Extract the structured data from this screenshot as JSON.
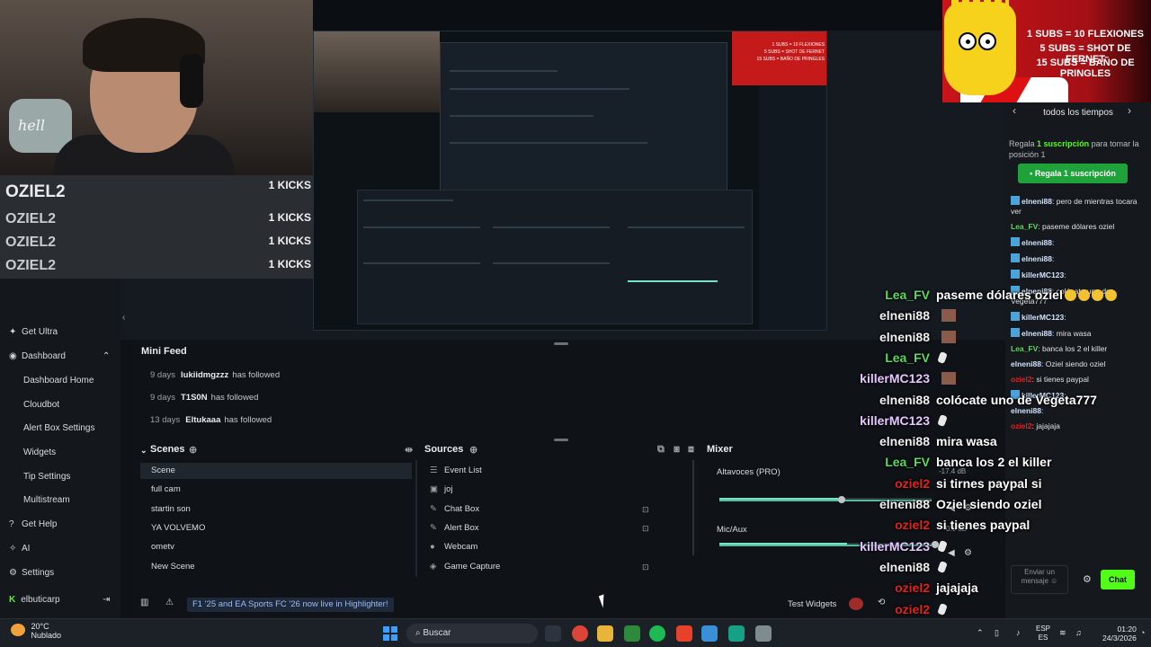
{
  "kicks": [
    {
      "name": "OZIEL2",
      "count": "1 KICKS"
    },
    {
      "name": "OZIEL2",
      "count": "1 KICKS"
    },
    {
      "name": "OZIEL2",
      "count": "1 KICKS"
    },
    {
      "name": "OZIEL2",
      "count": "1 KICKS"
    }
  ],
  "bart_overlay": {
    "line1": "1 SUBS = 10 FLEXIONES",
    "line2": "5 SUBS = SHOT DE FERNET",
    "line3": "15 SUBS = BAÑO DE PRINGLES"
  },
  "chat_side": {
    "header": "todos los tiempos",
    "gift_desc_pre": "Regala",
    "gift_desc_bold": "1 suscripción",
    "gift_desc_post": "para tomar la posición 1",
    "gift_button": "Regala 1 suscripción",
    "messages": [
      {
        "user": "elneni88",
        "text": ": pero de mientras tocara ver",
        "cls": "user-elneni",
        "badge": true
      },
      {
        "user": "Lea_FV",
        "text": ": paseme dólares oziel",
        "cls": "user-lea",
        "badge": false
      },
      {
        "user": "elneni88",
        "text": ":",
        "cls": "user-elneni",
        "badge": true
      },
      {
        "user": "elneni88",
        "text": ":",
        "cls": "user-elneni",
        "badge": true
      },
      {
        "user": "killerMC123",
        "text": ":",
        "cls": "user-killer",
        "badge": true
      },
      {
        "user": "elneni88",
        "text": ": colócate uno de Vegeta777",
        "cls": "user-elneni",
        "badge": true
      },
      {
        "user": "killerMC123",
        "text": ":",
        "cls": "user-killer",
        "badge": true
      },
      {
        "user": "elneni88",
        "text": ": mira wasa",
        "cls": "user-elneni",
        "badge": true
      },
      {
        "user": "Lea_FV",
        "text": ": banca los 2 el killer",
        "cls": "user-lea",
        "badge": false
      },
      {
        "user": "elneni88",
        "text": ": Oziel siendo oziel",
        "cls": "user-elneni",
        "badge": false
      },
      {
        "user": "oziel2",
        "text": ": si tienes paypal",
        "cls": "user-elneni",
        "badge": false
      },
      {
        "user": "killerMC123",
        "text": ":",
        "cls": "user-killer",
        "badge": true
      },
      {
        "user": "elneni88",
        "text": ":",
        "cls": "user-elneni",
        "badge": false
      },
      {
        "user": "oziel2",
        "text": ": jajajaja",
        "cls": "user-elneni",
        "badge": false
      }
    ],
    "input_placeholder": "Enviar un mensaje",
    "send_label": "Chat"
  },
  "sidebar": {
    "items": [
      {
        "label": "Get Ultra",
        "icon": "rocket-icon",
        "glyph": "✦",
        "sub": false
      },
      {
        "label": "Dashboard",
        "icon": "dashboard-icon",
        "glyph": "◉",
        "sub": false
      },
      {
        "label": "Dashboard Home",
        "icon": "",
        "glyph": "",
        "sub": true
      },
      {
        "label": "Cloudbot",
        "icon": "",
        "glyph": "",
        "sub": true
      },
      {
        "label": "Alert Box Settings",
        "icon": "",
        "glyph": "",
        "sub": true
      },
      {
        "label": "Widgets",
        "icon": "",
        "glyph": "",
        "sub": true
      },
      {
        "label": "Tip Settings",
        "icon": "",
        "glyph": "",
        "sub": true
      },
      {
        "label": "Multistream",
        "icon": "",
        "glyph": "",
        "sub": true
      },
      {
        "label": "Get Help",
        "icon": "help-icon",
        "glyph": "?",
        "sub": false
      },
      {
        "label": "AI",
        "icon": "ai-icon",
        "glyph": "✧",
        "sub": false
      },
      {
        "label": "Settings",
        "icon": "gear-icon",
        "glyph": "⚙",
        "sub": false
      }
    ],
    "user": "elbuticarp"
  },
  "mini_feed": {
    "title": "Mini Feed",
    "rows": [
      {
        "time": "9 days",
        "who": "lukiidmgzzz",
        "action": "has followed"
      },
      {
        "time": "9 days",
        "who": "T1S0N",
        "action": "has followed"
      },
      {
        "time": "13 days",
        "who": "Eltukaaa",
        "action": "has followed"
      }
    ]
  },
  "scenes": {
    "title": "Scenes",
    "items": [
      "Scene",
      "full cam",
      "startin son",
      "YA VOLVEMO",
      "ometv",
      "New Scene"
    ]
  },
  "sources": {
    "title": "Sources",
    "items": [
      {
        "label": "Event List",
        "icon": "list-icon",
        "glyph": "☰",
        "lock": false
      },
      {
        "label": "joj",
        "icon": "image-icon",
        "glyph": "▣",
        "lock": false
      },
      {
        "label": "Chat Box",
        "icon": "chat-icon",
        "glyph": "✎",
        "lock": true
      },
      {
        "label": "Alert Box",
        "icon": "alert-icon",
        "glyph": "✎",
        "lock": true
      },
      {
        "label": "Webcam",
        "icon": "webcam-icon",
        "glyph": "●",
        "lock": false
      },
      {
        "label": "Game Capture",
        "icon": "gamepad-icon",
        "glyph": "◈",
        "lock": true
      }
    ]
  },
  "mixer": {
    "title": "Mixer",
    "channels": [
      {
        "label": "Altavoces (PRO)",
        "db": "-17.4 dB",
        "level": 0.8
      },
      {
        "label": "Mic/Aux",
        "db": "0.0 dB",
        "level": 0.0
      }
    ]
  },
  "statusbar": {
    "notification": "F1 '25 and EA Sports FC '26 now live in Highlighter!",
    "test_widgets": "Test Widgets"
  },
  "overlay_chat": [
    {
      "user": "Lea_FV",
      "text": "paseme dólares oziel",
      "color": "#5dd75d"
    },
    {
      "user": "elneni88",
      "text": "",
      "color": "#f0f0f0"
    },
    {
      "user": "elneni88",
      "text": "",
      "color": "#f0f0f0"
    },
    {
      "user": "Lea_FV",
      "text": "",
      "color": "#5dd75d"
    },
    {
      "user": "killerMC123",
      "text": "",
      "color": "#e7c6ff"
    },
    {
      "user": "elneni88",
      "text": "colócate uno de Vegeta777",
      "color": "#f0f0f0"
    },
    {
      "user": "killerMC123",
      "text": "",
      "color": "#e7c6ff"
    },
    {
      "user": "elneni88",
      "text": "mira wasa",
      "color": "#f0f0f0"
    },
    {
      "user": "Lea_FV",
      "text": "banca los 2 el killer",
      "color": "#5dd75d"
    },
    {
      "user": "oziel2",
      "text": "si tirnes paypal si",
      "color": "#e0231c"
    },
    {
      "user": "elneni88",
      "text": "Oziel siendo oziel",
      "color": "#f0f0f0"
    },
    {
      "user": "oziel2",
      "text": "si tienes paypal",
      "color": "#e0231c"
    },
    {
      "user": "killerMC123",
      "text": "",
      "color": "#e7c6ff"
    },
    {
      "user": "elneni88",
      "text": "",
      "color": "#f0f0f0"
    },
    {
      "user": "oziel2",
      "text": "jajajaja",
      "color": "#e0231c"
    },
    {
      "user": "oziel2",
      "text": "",
      "color": "#e0231c"
    }
  ],
  "taskbar": {
    "temp": "20°C",
    "weather": "Nublado",
    "search": "Buscar",
    "lang1": "ESP",
    "lang2": "ES",
    "time": "01:20",
    "date": "24/3/2026"
  },
  "colors": {
    "kick_green": "#53fc18",
    "mixer_green": "#78e3c4",
    "lea_green": "#5dd75d",
    "oziel_red": "#e0231c",
    "killer_purple": "#e7c6ff"
  }
}
